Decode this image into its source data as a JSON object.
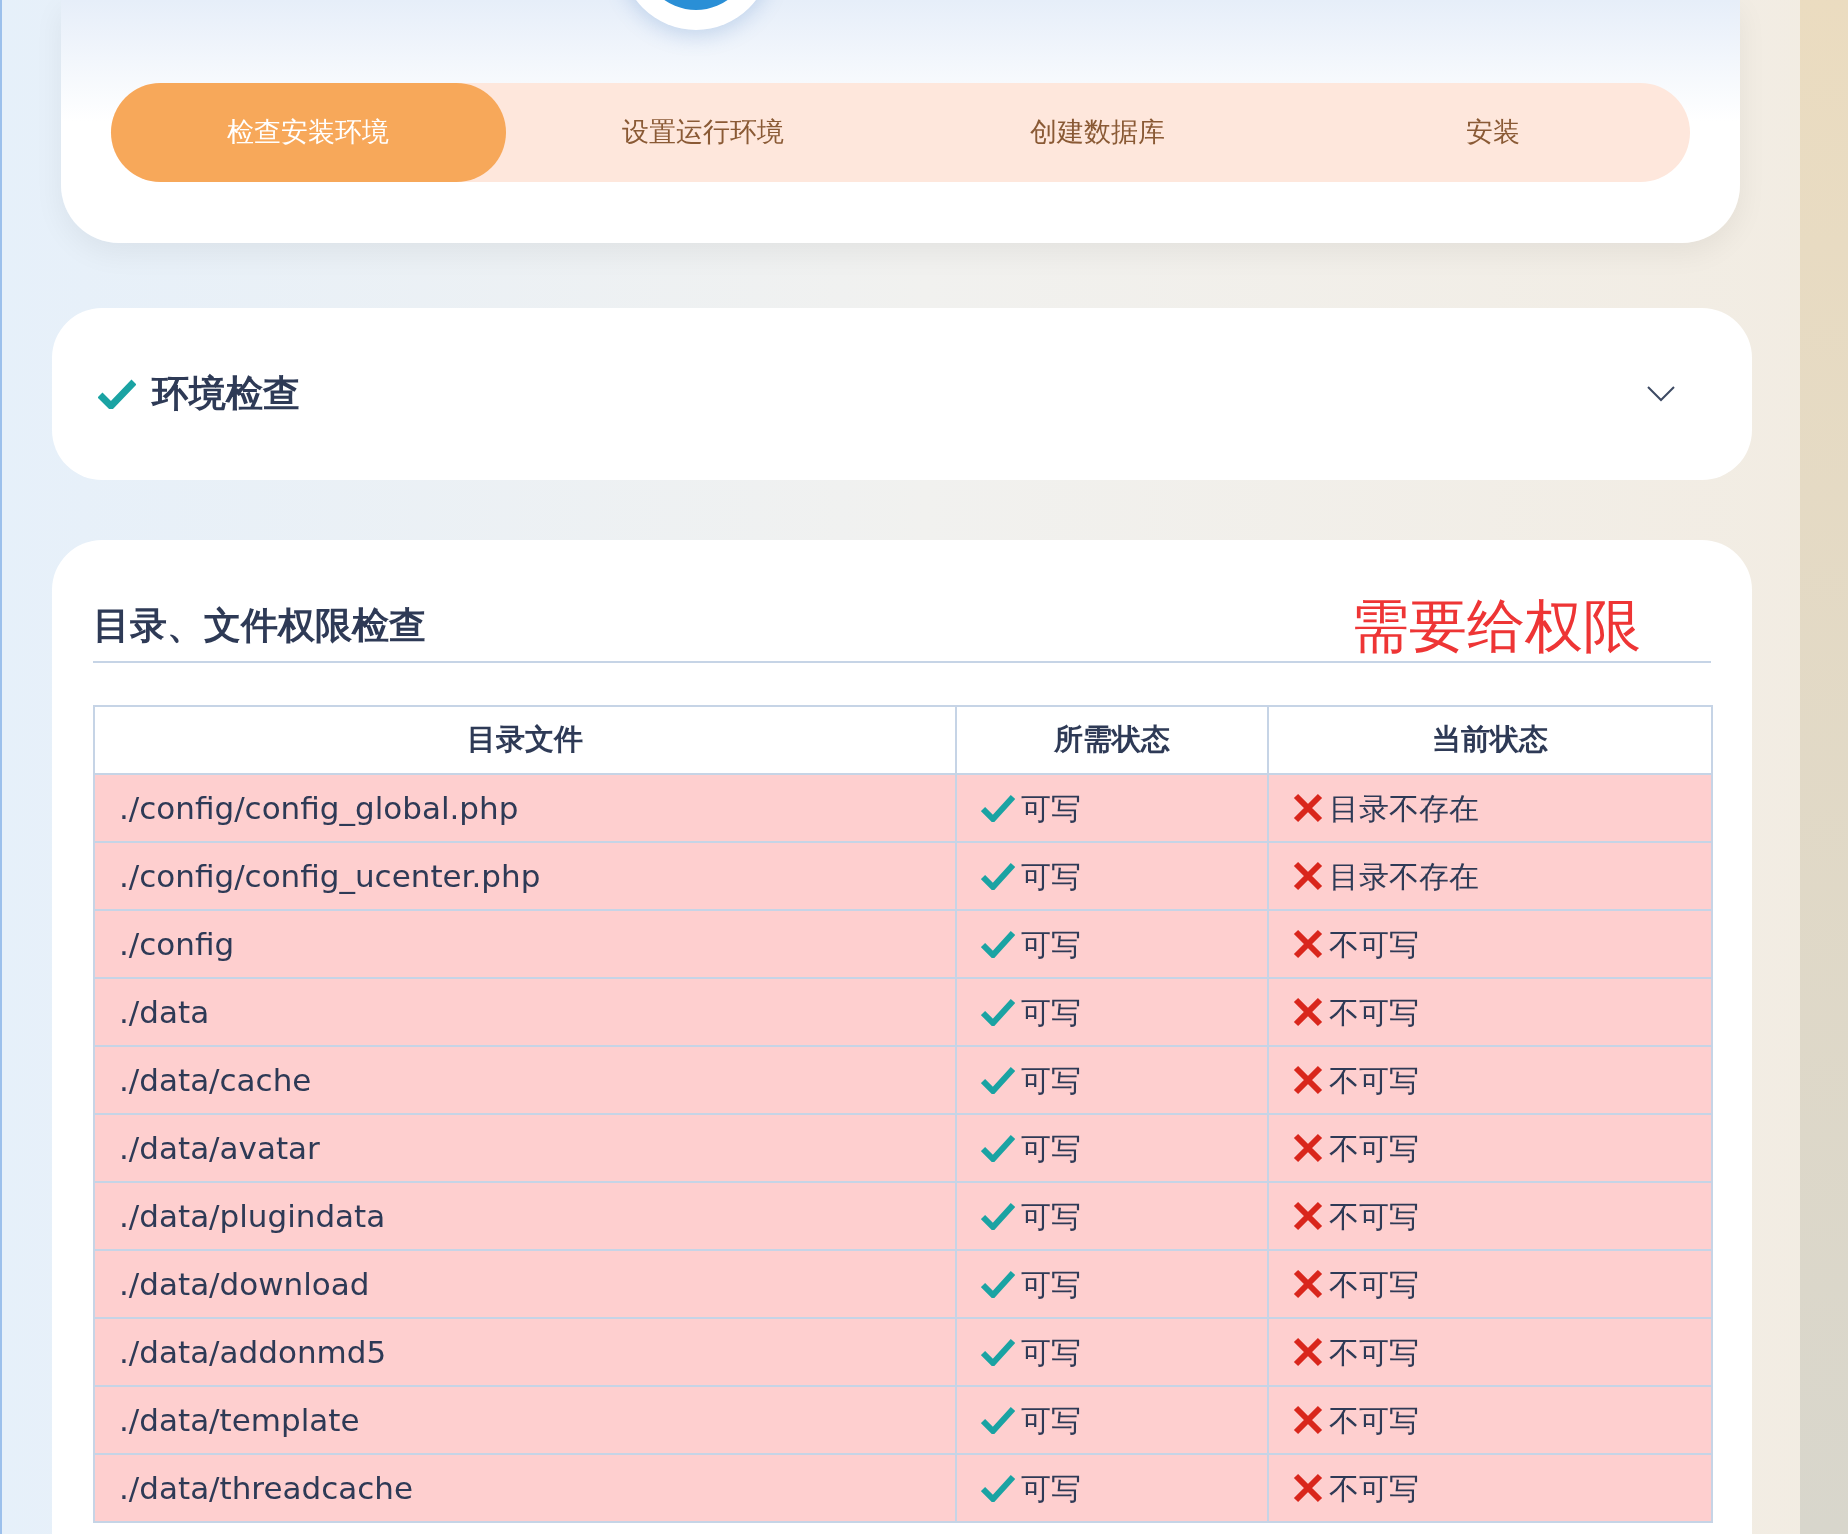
{
  "steps": [
    {
      "label": "检查安装环境",
      "selected": true
    },
    {
      "label": "设置运行环境",
      "selected": false
    },
    {
      "label": "创建数据库",
      "selected": false
    },
    {
      "label": "安装",
      "selected": false
    }
  ],
  "env_check": {
    "title": "环境检查",
    "passed": true,
    "expanded": false
  },
  "permissions": {
    "title": "目录、文件权限检查",
    "note": "需要给权限",
    "columns": [
      "目录文件",
      "所需状态",
      "当前状态"
    ],
    "rows": [
      {
        "path": "./config/config_global.php",
        "required": {
          "ok": true,
          "text": "可写"
        },
        "current": {
          "ok": false,
          "text": "目录不存在"
        }
      },
      {
        "path": "./config/config_ucenter.php",
        "required": {
          "ok": true,
          "text": "可写"
        },
        "current": {
          "ok": false,
          "text": "目录不存在"
        }
      },
      {
        "path": "./config",
        "required": {
          "ok": true,
          "text": "可写"
        },
        "current": {
          "ok": false,
          "text": "不可写"
        }
      },
      {
        "path": "./data",
        "required": {
          "ok": true,
          "text": "可写"
        },
        "current": {
          "ok": false,
          "text": "不可写"
        }
      },
      {
        "path": "./data/cache",
        "required": {
          "ok": true,
          "text": "可写"
        },
        "current": {
          "ok": false,
          "text": "不可写"
        }
      },
      {
        "path": "./data/avatar",
        "required": {
          "ok": true,
          "text": "可写"
        },
        "current": {
          "ok": false,
          "text": "不可写"
        }
      },
      {
        "path": "./data/plugindata",
        "required": {
          "ok": true,
          "text": "可写"
        },
        "current": {
          "ok": false,
          "text": "不可写"
        }
      },
      {
        "path": "./data/download",
        "required": {
          "ok": true,
          "text": "可写"
        },
        "current": {
          "ok": false,
          "text": "不可写"
        }
      },
      {
        "path": "./data/addonmd5",
        "required": {
          "ok": true,
          "text": "可写"
        },
        "current": {
          "ok": false,
          "text": "不可写"
        }
      },
      {
        "path": "./data/template",
        "required": {
          "ok": true,
          "text": "可写"
        },
        "current": {
          "ok": false,
          "text": "不可写"
        }
      },
      {
        "path": "./data/threadcache",
        "required": {
          "ok": true,
          "text": "可写"
        },
        "current": {
          "ok": false,
          "text": "不可写"
        }
      }
    ]
  }
}
